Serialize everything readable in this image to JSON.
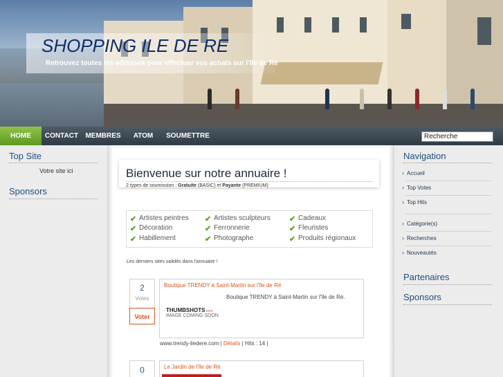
{
  "header": {
    "site_title": "SHOPPING ILE DE RE",
    "site_subtitle": "Retrouvez toutes les adresses pour effectuer vos achats sur l'Ile de Ré"
  },
  "nav": {
    "items": [
      "HOME",
      "CONTACT",
      "MEMBRES",
      "ATOM",
      "SOUMETTRE"
    ],
    "search_value": "Recherche",
    "active_color": "#7ab336"
  },
  "left_sidebar": {
    "top_site_heading": "Top Site",
    "top_site_text": "Votre site ici",
    "sponsors_heading": "Sponsors"
  },
  "right_sidebar": {
    "navigation_heading": "Navigation",
    "nav_items": [
      "Accueil",
      "Top Votes",
      "Top Hits",
      "Catégorie(s)",
      "Recherches",
      "Nouveautés"
    ],
    "partenaires_heading": "Partenaires",
    "sponsors_heading": "Sponsors"
  },
  "main": {
    "welcome_title": "Bienvenue sur notre annuaire !",
    "welcome_sub_prefix": "2 types de soumission : ",
    "welcome_sub_free": "Gratuite",
    "welcome_sub_basic": " (BASIC) et ",
    "welcome_sub_paid": "Payante",
    "welcome_sub_premium": " (PREMIUM)",
    "categories": [
      "Artistes peintres",
      "Artistes sculpteurs",
      "Cadeaux",
      "Décoration",
      "Ferronnerie",
      "Fleuristes",
      "Habillement",
      "Photographe",
      "Produits régionaux"
    ],
    "latest_text": "Les derniers sites validés dans l'annuaire !",
    "entries": [
      {
        "votes": "2",
        "votes_label": "Votes",
        "vote_button": "Voter",
        "title": "Boutique TRENDY à Saint-Martin sur l'île de Ré",
        "description": "Boutique TRENDY à Saint-Martin sur l'île de Ré.",
        "thumb_brand": "THUMBSHOTS",
        "thumb_domain": ".com",
        "thumb_caption": "IMAGE COMING SOON",
        "url": "www.trendy-iledere.com",
        "details_label": "Détails",
        "hits_text": "Hits : 14"
      },
      {
        "votes": "0",
        "title": "Le Jardin de l'île de Ré"
      }
    ]
  }
}
